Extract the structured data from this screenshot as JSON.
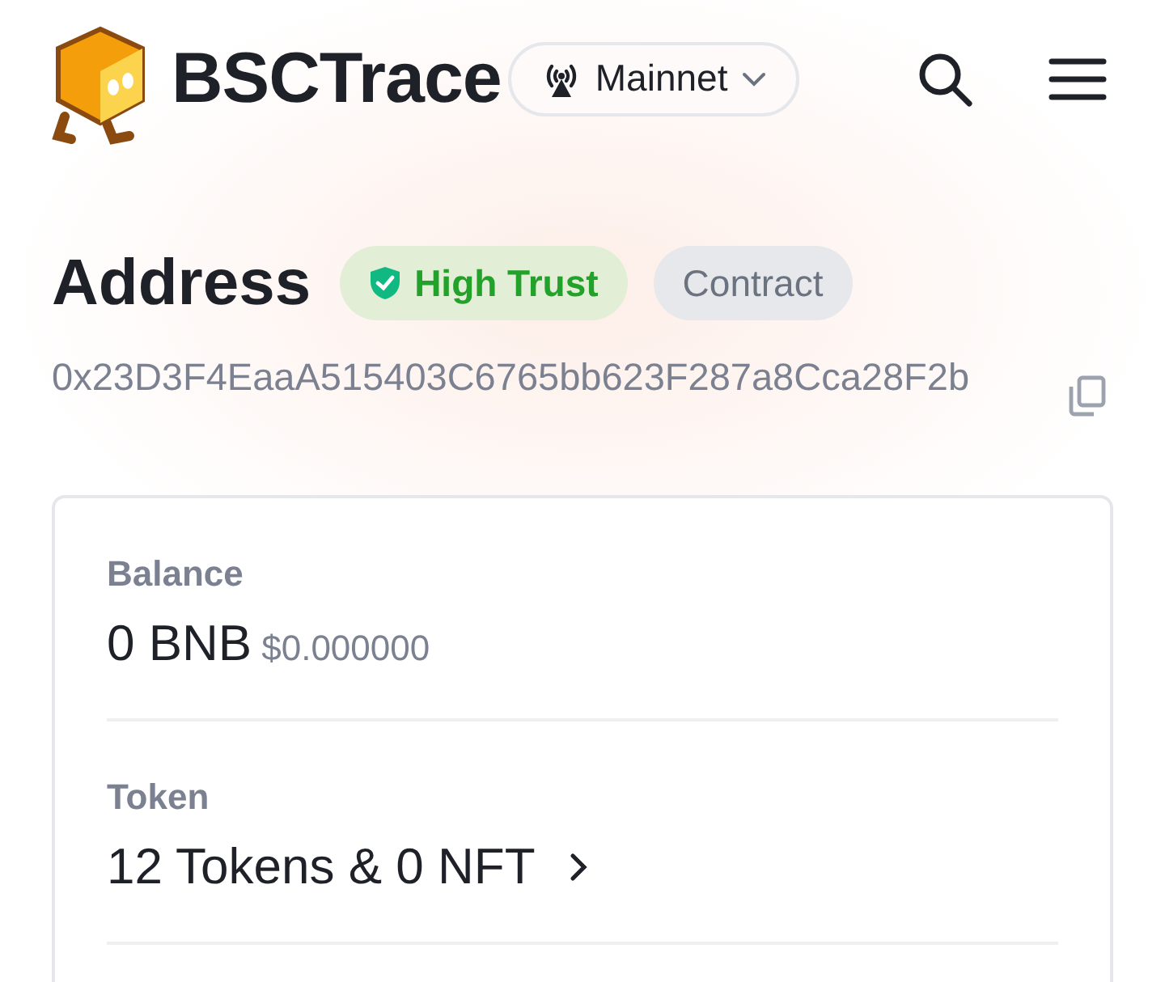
{
  "header": {
    "brand": "BSCTrace",
    "network": "Mainnet"
  },
  "address": {
    "title": "Address",
    "badges": [
      {
        "kind": "trust",
        "label": "High Trust"
      },
      {
        "kind": "type",
        "label": "Contract"
      }
    ],
    "hash": "0x23D3F4EaaA515403C6765bb623F287a8Cca28F2b"
  },
  "card": {
    "sections": [
      {
        "kind": "balance",
        "label": "Balance",
        "value": "0 BNB",
        "sub": "$0.000000"
      },
      {
        "kind": "link",
        "label": "Token",
        "value": "12 Tokens & 0 NFT"
      }
    ]
  }
}
